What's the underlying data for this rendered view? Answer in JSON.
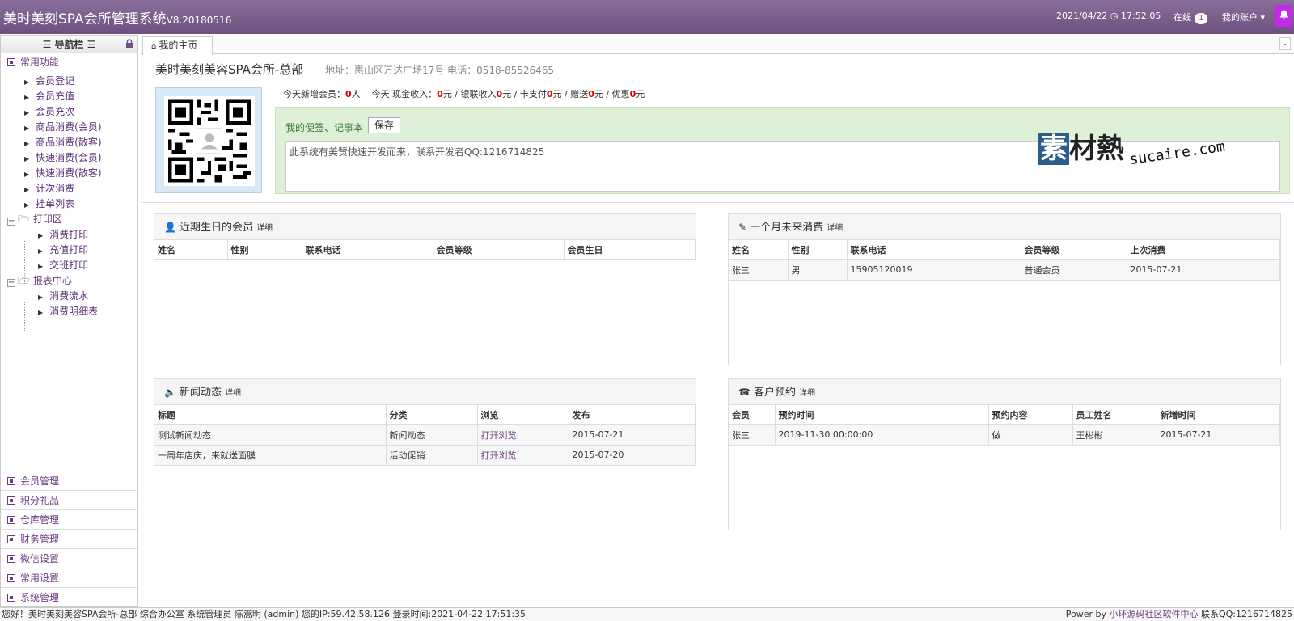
{
  "header": {
    "app_title": "美时美刻SPA会所管理系统",
    "version": "V8.20180516",
    "datetime": "2021/04/22 ◷ 17:52:05",
    "online_label": "在线",
    "online_count": "1",
    "account_label": "我的账户 ▾",
    "bell_icon": "bell-icon"
  },
  "sidebar": {
    "title": "☰ 导航栏 ☰",
    "common_group": "常用功能",
    "common_items": [
      "会员登记",
      "会员充值",
      "会员充次",
      "商品消费(会员)",
      "商品消费(散客)",
      "快速消费(会员)",
      "快速消费(散客)",
      "计次消费",
      "挂单列表"
    ],
    "print_folder": "打印区",
    "print_items": [
      "消费打印",
      "充值打印",
      "交班打印"
    ],
    "report_folder": "报表中心",
    "report_items": [
      "消费流水",
      "消费明细表"
    ],
    "bottom_groups": [
      "会员管理",
      "积分礼品",
      "仓库管理",
      "财务管理",
      "微信设置",
      "常用设置",
      "系统管理"
    ]
  },
  "tabs": {
    "home": "我的主页"
  },
  "org": {
    "name": "美时美刻美容SPA会所-总部",
    "address": "地址：惠山区万达广场17号 电话：0518-85526465"
  },
  "stats": {
    "new_members_label": "今天新增会员：",
    "new_members": "0",
    "new_members_unit": "人",
    "cash_label": "今天 现金收入：",
    "cash": "0",
    "union_label": "元 / 银联收入",
    "union": "0",
    "card_label": "元 / 卡支付",
    "card": "0",
    "gift_label": "元 / 赠送",
    "gift": "0",
    "discount_label": "元 / 优惠",
    "discount": "0",
    "unit_yuan": "元"
  },
  "memo": {
    "label": "我的便签、记事本",
    "save": "保存",
    "content": "此系统有美赞快速开发而来，联系开发者QQ:1216714825"
  },
  "watermark": {
    "cn_first": "素",
    "cn_rest": "材熱",
    "en": "sucaire.com"
  },
  "panels": {
    "more": "详细",
    "birthday": {
      "title": "近期生日的会员",
      "columns": [
        "姓名",
        "性别",
        "联系电话",
        "会员等级",
        "会员生日"
      ],
      "rows": []
    },
    "inactive": {
      "title": "一个月未来消费",
      "columns": [
        "姓名",
        "性别",
        "联系电话",
        "会员等级",
        "上次消费"
      ],
      "rows": [
        [
          "张三",
          "男",
          "15905120019",
          "普通会员",
          "2015-07-21"
        ]
      ]
    },
    "news": {
      "title": "新闻动态",
      "columns": [
        "标题",
        "分类",
        "浏览",
        "发布"
      ],
      "rows": [
        [
          "测试新闻动态",
          "新闻动态",
          "打开浏览",
          "2015-07-21"
        ],
        [
          "一周年店庆，来就送面膜",
          "活动促销",
          "打开浏览",
          "2015-07-20"
        ]
      ]
    },
    "booking": {
      "title": "客户预约",
      "columns": [
        "会员",
        "预约时间",
        "预约内容",
        "员工姓名",
        "新增时间"
      ],
      "rows": [
        [
          "张三",
          "2019-11-30 00:00:00",
          "做",
          "王彬彬",
          "2015-07-21"
        ]
      ]
    }
  },
  "footer": {
    "left": "您好！美时美刻美容SPA会所-总部 综合办公室 系统管理员 陈嵩明 (admin) 您的IP:59.42.58.126 登录时间:2021-04-22 17:51:35",
    "right_prefix": "Power by ",
    "right_link": "小环源码社区软件中心",
    "right_suffix": " 联系QQ:1216714825"
  }
}
